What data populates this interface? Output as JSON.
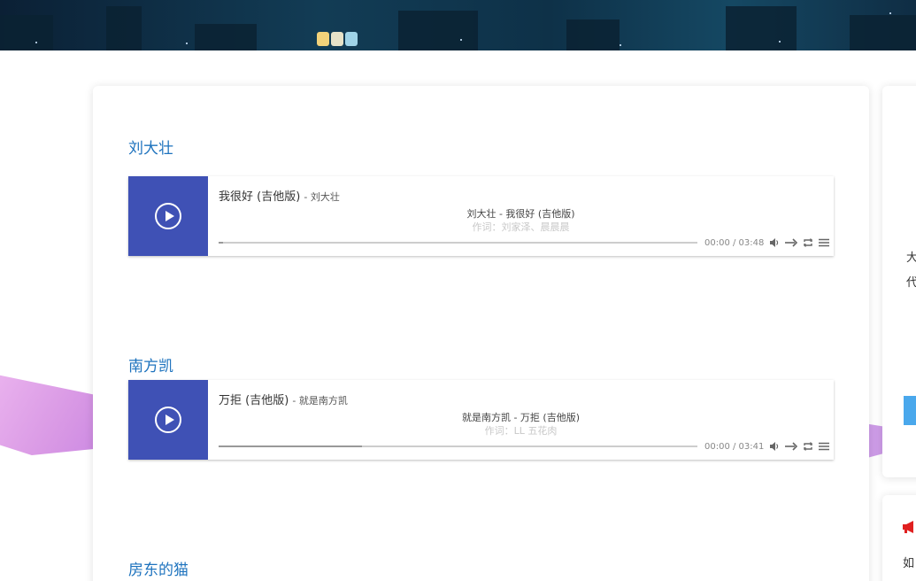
{
  "sections": [
    {
      "title": "刘大壮",
      "song": "我很好 (吉他版)",
      "author": "刘大壮",
      "lrc_current": "刘大壮 - 我很好 (吉他版)",
      "lrc_next": "作词：刘家泽、晨晨晨",
      "time": "00:00 / 03:48",
      "progress": 0.01
    },
    {
      "title": "南方凯",
      "song": "万拒 (吉他版)",
      "author": "就是南方凯",
      "lrc_current": "就是南方凯 - 万拒 (吉他版)",
      "lrc_next": "作词：LL 五花肉",
      "time": "00:00 / 03:41",
      "progress": 0.3
    },
    {
      "title": "房东的猫"
    }
  ],
  "sidebar": {
    "line1": "大",
    "line2": "代",
    "line3": "如"
  },
  "icons": [
    "play-icon",
    "volume-icon",
    "order-icon",
    "loop-icon",
    "menu-icon",
    "megaphone-icon"
  ],
  "colors": {
    "cover": "#3f51b5",
    "title": "#1e73be",
    "sidebar_button": "#4aa8ec",
    "accent_red": "#e02020"
  }
}
